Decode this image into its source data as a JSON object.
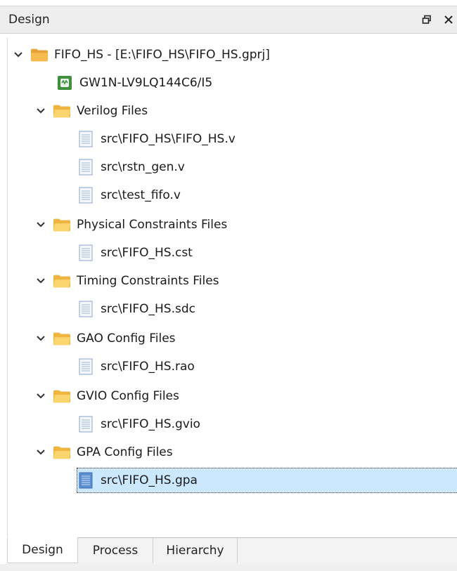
{
  "panel": {
    "title": "Design"
  },
  "tree": {
    "project_label": "FIFO_HS - [E:\\FIFO_HS\\FIFO_HS.gprj]",
    "device_label": "GW1N-LV9LQ144C6/I5",
    "groups": [
      {
        "label": "Verilog Files",
        "files": [
          "src\\FIFO_HS\\FIFO_HS.v",
          "src\\rstn_gen.v",
          "src\\test_fifo.v"
        ]
      },
      {
        "label": "Physical Constraints Files",
        "files": [
          "src\\FIFO_HS.cst"
        ]
      },
      {
        "label": "Timing Constraints Files",
        "files": [
          "src\\FIFO_HS.sdc"
        ]
      },
      {
        "label": "GAO Config Files",
        "files": [
          "src\\FIFO_HS.rao"
        ]
      },
      {
        "label": "GVIO Config Files",
        "files": [
          "src\\FIFO_HS.gvio"
        ]
      },
      {
        "label": "GPA Config Files",
        "files": [
          "src\\FIFO_HS.gpa"
        ]
      }
    ],
    "selected_file": "src\\FIFO_HS.gpa"
  },
  "tabs": [
    {
      "label": "Design",
      "active": true
    },
    {
      "label": "Process",
      "active": false
    },
    {
      "label": "Hierarchy",
      "active": false
    }
  ],
  "colors": {
    "selection": "#cce8ff",
    "folder": "#f5c342",
    "chip": "#3f8f3f"
  }
}
